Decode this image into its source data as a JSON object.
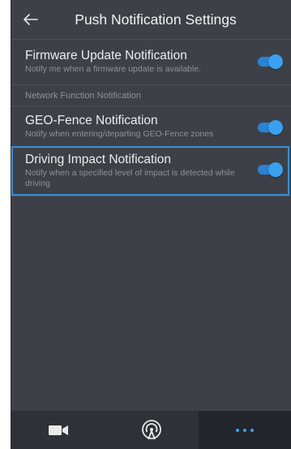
{
  "header": {
    "title": "Push Notification Settings",
    "back_icon": "arrow-left-icon"
  },
  "settings": {
    "firmware": {
      "title": "Firmware Update Notification",
      "subtitle": "Notify me when a firmware update is available.",
      "enabled": true
    },
    "section_label": "Network Function Notification",
    "geofence": {
      "title": "GEO-Fence Notification",
      "subtitle": "Notify when entering/departing GEO-Fence zones",
      "enabled": true
    },
    "impact": {
      "title": "Driving Impact Notification",
      "subtitle": "Notify when a specified level of impact is detected while driving",
      "enabled": true
    }
  },
  "bottom_nav": {
    "items": [
      "video-camera-icon",
      "wireless-signal-icon",
      "more-dots-icon"
    ],
    "active": "more-dots-icon"
  },
  "colors": {
    "background": "#3d4147",
    "accent": "#3aa0f0",
    "highlight_border": "#3a8fd6"
  }
}
